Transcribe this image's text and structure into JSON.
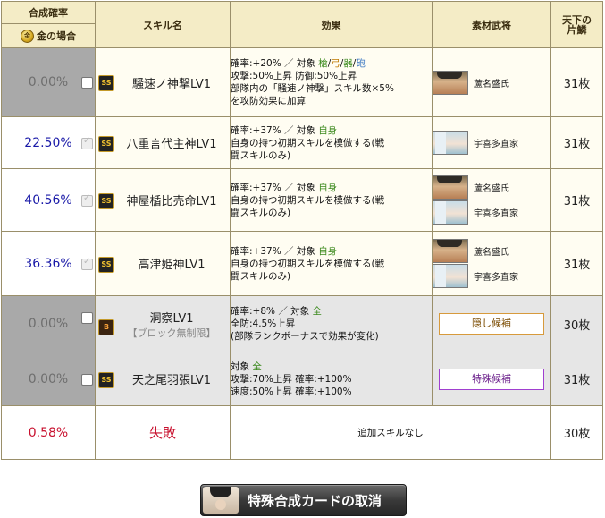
{
  "header": {
    "rate_title": "合成確率",
    "gold_mark": "金",
    "gold_label": "金の場合",
    "skill_name": "スキル名",
    "effect": "効果",
    "materials": "素材武将",
    "tenka_line1": "天下の",
    "tenka_line2": "片鱗"
  },
  "rows": [
    {
      "rate": "0.00%",
      "rank": "SS",
      "skill": "騒速ノ神撃LV1",
      "effect": {
        "l1_pre": "確率:+20% ／ 対象 ",
        "t1": "槍",
        "sep1": "/",
        "t2": "弓",
        "sep2": "/",
        "t3": "器",
        "sep3": "/",
        "t4": "砲",
        "l2": "攻撃:50%上昇 防御:50%上昇",
        "l3": "部隊内の「騒速ノ神撃」スキル数×5%",
        "l4": "を攻防効果に加算"
      },
      "materials": [
        {
          "name": "蘆名盛氏"
        }
      ],
      "count": "31枚"
    },
    {
      "rate": "22.50%",
      "rank": "SS",
      "skill": "八重言代主神LV1",
      "effect": {
        "l1_pre": "確率:+37% ／ 対象 ",
        "target": "自身",
        "l2": "自身の持つ初期スキルを模倣する(戦",
        "l3": "闘スキルのみ)"
      },
      "materials": [
        {
          "name": "宇喜多直家"
        }
      ],
      "count": "31枚"
    },
    {
      "rate": "40.56%",
      "rank": "SS",
      "skill": "神屋楯比売命LV1",
      "effect": {
        "l1_pre": "確率:+37% ／ 対象 ",
        "target": "自身",
        "l2": "自身の持つ初期スキルを模倣する(戦",
        "l3": "闘スキルのみ)"
      },
      "materials": [
        {
          "name": "蘆名盛氏"
        },
        {
          "name": "宇喜多直家"
        }
      ],
      "count": "31枚"
    },
    {
      "rate": "36.36%",
      "rank": "SS",
      "skill": "高津姫神LV1",
      "effect": {
        "l1_pre": "確率:+37% ／ 対象 ",
        "target": "自身",
        "l2": "自身の持つ初期スキルを模倣する(戦",
        "l3": "闘スキルのみ)"
      },
      "materials": [
        {
          "name": "蘆名盛氏"
        },
        {
          "name": "宇喜多直家"
        }
      ],
      "count": "31枚"
    },
    {
      "rate": "0.00%",
      "rank": "B",
      "skill": "洞察LV1",
      "note": "【ブロック無制限】",
      "effect": {
        "l1_pre": "確率:+8% ／ 対象 ",
        "target": "全",
        "l2": "全防:4.5%上昇",
        "l3": "(部隊ランクボーナスで効果が変化)"
      },
      "candidate": "隠し候補",
      "count": "30枚"
    },
    {
      "rate": "0.00%",
      "rank": "SS",
      "skill": "天之尾羽張LV1",
      "effect": {
        "l1_pre": "対象 ",
        "target": "全",
        "l2": "攻撃:70%上昇 確率:+100%",
        "l3": "速度:50%上昇 確率:+100%"
      },
      "candidate": "特殊候補",
      "count": "31枚"
    },
    {
      "rate": "0.58%",
      "skill": "失敗",
      "effect": {
        "none": "追加スキルなし"
      },
      "count": "30枚"
    }
  ],
  "footer": {
    "cancel_label": "特殊合成カードの取消"
  },
  "colors": {
    "header_bg": "#f4ecc6",
    "grey_rate_bg": "#a9a9a9",
    "blue_rate": "#1a1aa8",
    "red_rate": "#c8102e",
    "target_green": "#3c8a1e"
  }
}
